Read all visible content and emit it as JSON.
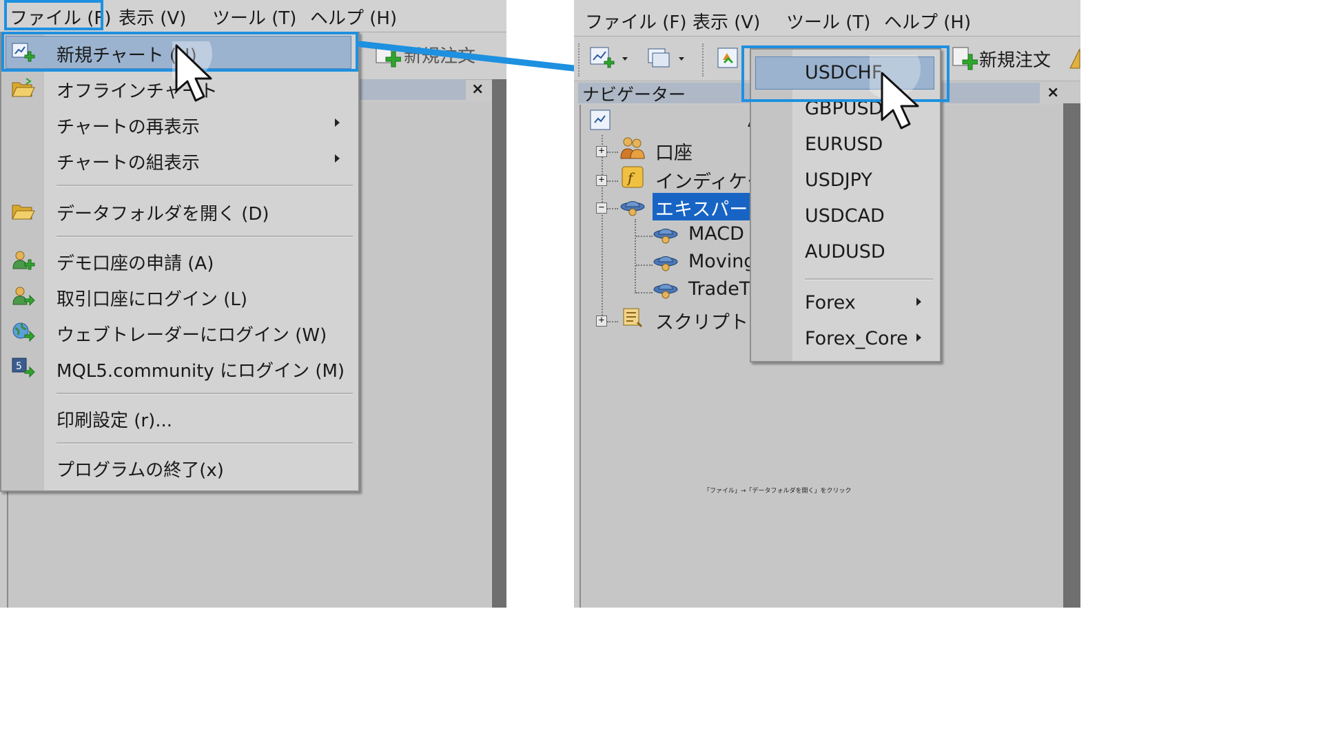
{
  "menubar": {
    "file": "ファイル (F)",
    "view": "表示 (V)",
    "tools": "ツール (T)",
    "help": "ヘルプ (H)"
  },
  "left": {
    "toolbar_partial_label": "新規注文",
    "file_menu": {
      "new_chart": "新規チャート (N)",
      "offline_chart": "オフラインチャート",
      "reshow_chart": "チャートの再表示",
      "chart_set": "チャートの組表示",
      "open_data_folder": "データフォルダを開く (D)",
      "demo_account": "デモ口座の申請 (A)",
      "login_trade": "取引口座にログイン (L)",
      "login_webtrader": "ウェブトレーダーにログイン (W)",
      "login_mql5": "MQL5.community にログイン (M)",
      "print_setup": "印刷設定 (r)...",
      "exit": "プログラムの終了(x)"
    },
    "close_glyph": "×"
  },
  "right": {
    "toolbar_new_order": "新規注文",
    "navigator_title": "ナビゲーター",
    "close_glyph": "×",
    "tree": {
      "accounts": "口座",
      "indicators": "インディケータ",
      "experts": "エキスパートア",
      "expert_1": "MACD S",
      "expert_2": "Moving",
      "expert_3": "TradeTr",
      "scripts": "スクリプト",
      "fragment_a": "A"
    },
    "symbol_menu": {
      "items": [
        "USDCHF",
        "GBPUSD",
        "EURUSD",
        "USDJPY",
        "USDCAD",
        "AUDUSD"
      ],
      "submenus": [
        "Forex",
        "Forex_Core"
      ]
    },
    "caption": "「ファイル」→「データフォルダを開く」をクリック"
  },
  "colors": {
    "highlight_border": "#1e90e0",
    "selection_fill": "#9bb3cf",
    "tree_selection": "#1764c4",
    "menu_background": "#d3d3d3",
    "panel_background": "#c9c9c9"
  }
}
